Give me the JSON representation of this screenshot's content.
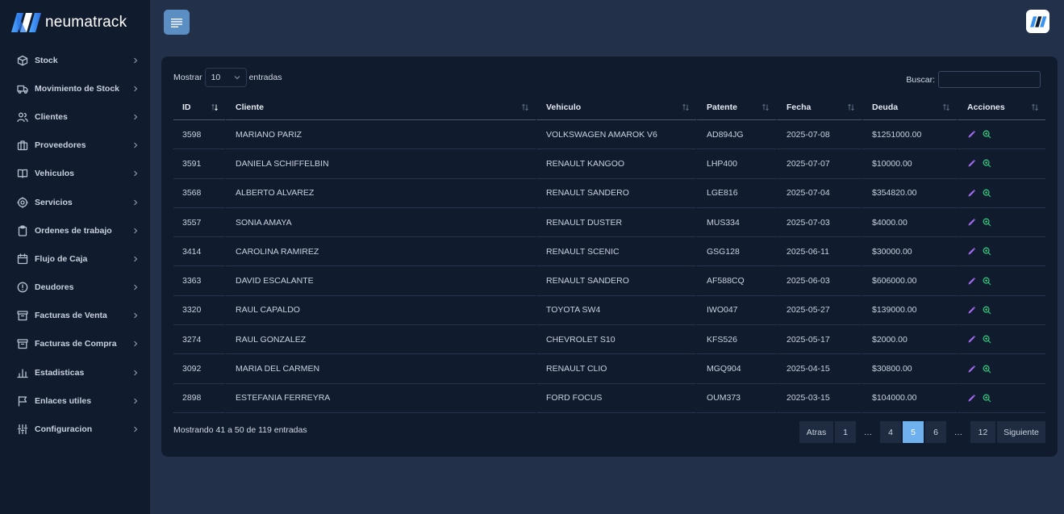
{
  "brand": {
    "name": "neumatrack"
  },
  "sidebar": {
    "items": [
      {
        "label": "Stock",
        "icon": "box-icon"
      },
      {
        "label": "Movimiento de Stock",
        "icon": "truck-icon"
      },
      {
        "label": "Clientes",
        "icon": "users-icon"
      },
      {
        "label": "Proveedores",
        "icon": "briefcase-icon"
      },
      {
        "label": "Vehiculos",
        "icon": "book-icon"
      },
      {
        "label": "Servicios",
        "icon": "gear-icon"
      },
      {
        "label": "Ordenes de trabajo",
        "icon": "clipboard-icon"
      },
      {
        "label": "Flujo de Caja",
        "icon": "calendar-icon"
      },
      {
        "label": "Deudores",
        "icon": "alert-circle-icon"
      },
      {
        "label": "Facturas de Venta",
        "icon": "archive-icon"
      },
      {
        "label": "Facturas de Compra",
        "icon": "archive-icon"
      },
      {
        "label": "Estadisticas",
        "icon": "bar-chart-icon"
      },
      {
        "label": "Enlaces utiles",
        "icon": "flag-icon"
      },
      {
        "label": "Configuracion",
        "icon": "sliders-icon"
      }
    ]
  },
  "table_controls": {
    "show_label": "Mostrar",
    "page_size": "10",
    "entries_label": "entradas",
    "search_label": "Buscar:",
    "search_value": ""
  },
  "table": {
    "columns": [
      "ID",
      "Cliente",
      "Vehiculo",
      "Patente",
      "Fecha",
      "Deuda",
      "Acciones"
    ],
    "rows": [
      {
        "id": "3598",
        "cliente": "MARIANO PARIZ",
        "vehiculo": "VOLKSWAGEN AMAROK V6",
        "patente": "AD894JG",
        "fecha": "2025-07-08",
        "deuda": "$1251000.00"
      },
      {
        "id": "3591",
        "cliente": "DANIELA SCHIFFELBIN",
        "vehiculo": "RENAULT KANGOO",
        "patente": "LHP400",
        "fecha": "2025-07-07",
        "deuda": "$10000.00"
      },
      {
        "id": "3568",
        "cliente": "ALBERTO ALVAREZ",
        "vehiculo": "RENAULT SANDERO",
        "patente": "LGE816",
        "fecha": "2025-07-04",
        "deuda": "$354820.00"
      },
      {
        "id": "3557",
        "cliente": "SONIA AMAYA",
        "vehiculo": "RENAULT DUSTER",
        "patente": "MUS334",
        "fecha": "2025-07-03",
        "deuda": "$4000.00"
      },
      {
        "id": "3414",
        "cliente": "CAROLINA RAMIREZ",
        "vehiculo": "RENAULT SCENIC",
        "patente": "GSG128",
        "fecha": "2025-06-11",
        "deuda": "$30000.00"
      },
      {
        "id": "3363",
        "cliente": "DAVID ESCALANTE",
        "vehiculo": "RENAULT SANDERO",
        "patente": "AF588CQ",
        "fecha": "2025-06-03",
        "deuda": "$606000.00"
      },
      {
        "id": "3320",
        "cliente": "RAUL CAPALDO",
        "vehiculo": "TOYOTA SW4",
        "patente": "IWO047",
        "fecha": "2025-05-27",
        "deuda": "$139000.00"
      },
      {
        "id": "3274",
        "cliente": "RAUL GONZALEZ",
        "vehiculo": "CHEVROLET S10",
        "patente": "KFS526",
        "fecha": "2025-05-17",
        "deuda": "$2000.00"
      },
      {
        "id": "3092",
        "cliente": "MARIA DEL CARMEN",
        "vehiculo": "RENAULT CLIO",
        "patente": "MGQ904",
        "fecha": "2025-04-15",
        "deuda": "$30800.00"
      },
      {
        "id": "2898",
        "cliente": "ESTEFANIA FERREYRA",
        "vehiculo": "FORD FOCUS",
        "patente": "OUM373",
        "fecha": "2025-03-15",
        "deuda": "$104000.00"
      }
    ]
  },
  "footer": {
    "info": "Mostrando 41 a 50 de 119 entradas",
    "pages": [
      {
        "label": "Atras",
        "type": "nav"
      },
      {
        "label": "1",
        "type": "page"
      },
      {
        "label": "…",
        "type": "dots"
      },
      {
        "label": "4",
        "type": "page"
      },
      {
        "label": "5",
        "type": "active"
      },
      {
        "label": "6",
        "type": "page"
      },
      {
        "label": "…",
        "type": "dots"
      },
      {
        "label": "12",
        "type": "page"
      },
      {
        "label": "Siguiente",
        "type": "nav"
      }
    ]
  },
  "colors": {
    "sidebar_bg": "#111b2e",
    "page_bg": "#223049",
    "accent": "#6fb1ee",
    "edit_icon": "#a66cf5",
    "view_icon": "#2fc27a"
  }
}
